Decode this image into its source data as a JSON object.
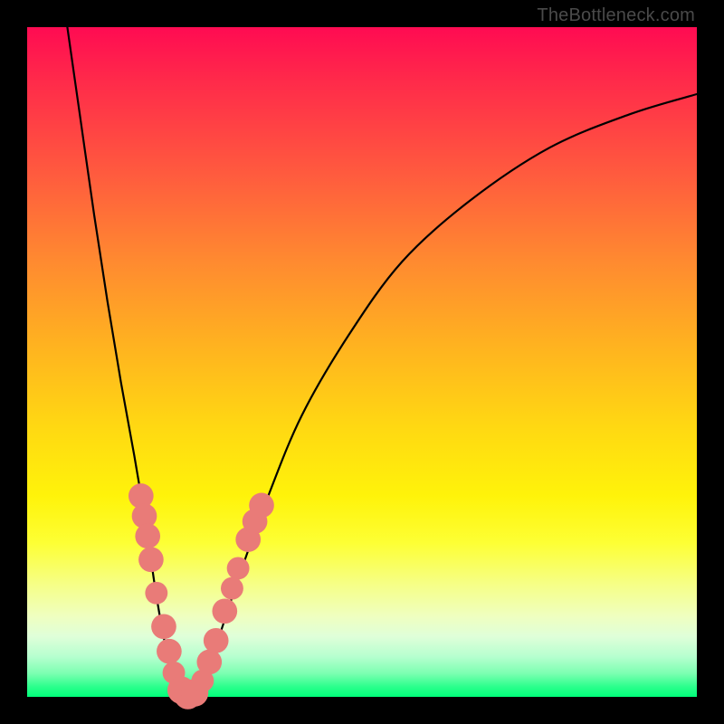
{
  "watermark": "TheBottleneck.com",
  "colors": {
    "frame": "#000000",
    "curve": "#000000",
    "marker_fill": "#e97b78",
    "marker_stroke": "#d76a67",
    "gradient_top": "#ff0b52",
    "gradient_bottom": "#00ff7a"
  },
  "chart_data": {
    "type": "line",
    "title": "",
    "xlabel": "",
    "ylabel": "",
    "xlim": [
      0,
      100
    ],
    "ylim": [
      0,
      100
    ],
    "series": [
      {
        "name": "bottleneck-curve",
        "x": [
          6,
          8,
          10,
          12,
          14,
          16,
          18,
          19,
          20,
          21,
          22,
          23,
          24,
          25,
          27,
          29,
          32,
          36,
          41,
          48,
          56,
          66,
          78,
          90,
          100
        ],
        "y": [
          100,
          86,
          72,
          59,
          47,
          36,
          24,
          17,
          11,
          6,
          2.5,
          0.8,
          0,
          0.9,
          4,
          10,
          19,
          30,
          42,
          54,
          65,
          74,
          82,
          87,
          90
        ]
      }
    ],
    "markers": [
      {
        "x": 17.0,
        "y": 30.0,
        "r": 1.4
      },
      {
        "x": 17.5,
        "y": 27.0,
        "r": 1.4
      },
      {
        "x": 18.0,
        "y": 24.0,
        "r": 1.4
      },
      {
        "x": 18.5,
        "y": 20.5,
        "r": 1.4
      },
      {
        "x": 19.3,
        "y": 15.5,
        "r": 1.2
      },
      {
        "x": 20.4,
        "y": 10.5,
        "r": 1.4
      },
      {
        "x": 21.2,
        "y": 6.8,
        "r": 1.4
      },
      {
        "x": 21.9,
        "y": 3.6,
        "r": 1.2
      },
      {
        "x": 23.0,
        "y": 1.0,
        "r": 1.6
      },
      {
        "x": 24.0,
        "y": 0.2,
        "r": 1.6
      },
      {
        "x": 25.0,
        "y": 0.6,
        "r": 1.6
      },
      {
        "x": 26.2,
        "y": 2.4,
        "r": 1.2
      },
      {
        "x": 27.2,
        "y": 5.2,
        "r": 1.4
      },
      {
        "x": 28.2,
        "y": 8.4,
        "r": 1.4
      },
      {
        "x": 29.5,
        "y": 12.8,
        "r": 1.4
      },
      {
        "x": 30.6,
        "y": 16.2,
        "r": 1.2
      },
      {
        "x": 31.5,
        "y": 19.2,
        "r": 1.2
      },
      {
        "x": 33.0,
        "y": 23.5,
        "r": 1.4
      },
      {
        "x": 34.0,
        "y": 26.2,
        "r": 1.4
      },
      {
        "x": 35.0,
        "y": 28.6,
        "r": 1.4
      }
    ]
  }
}
